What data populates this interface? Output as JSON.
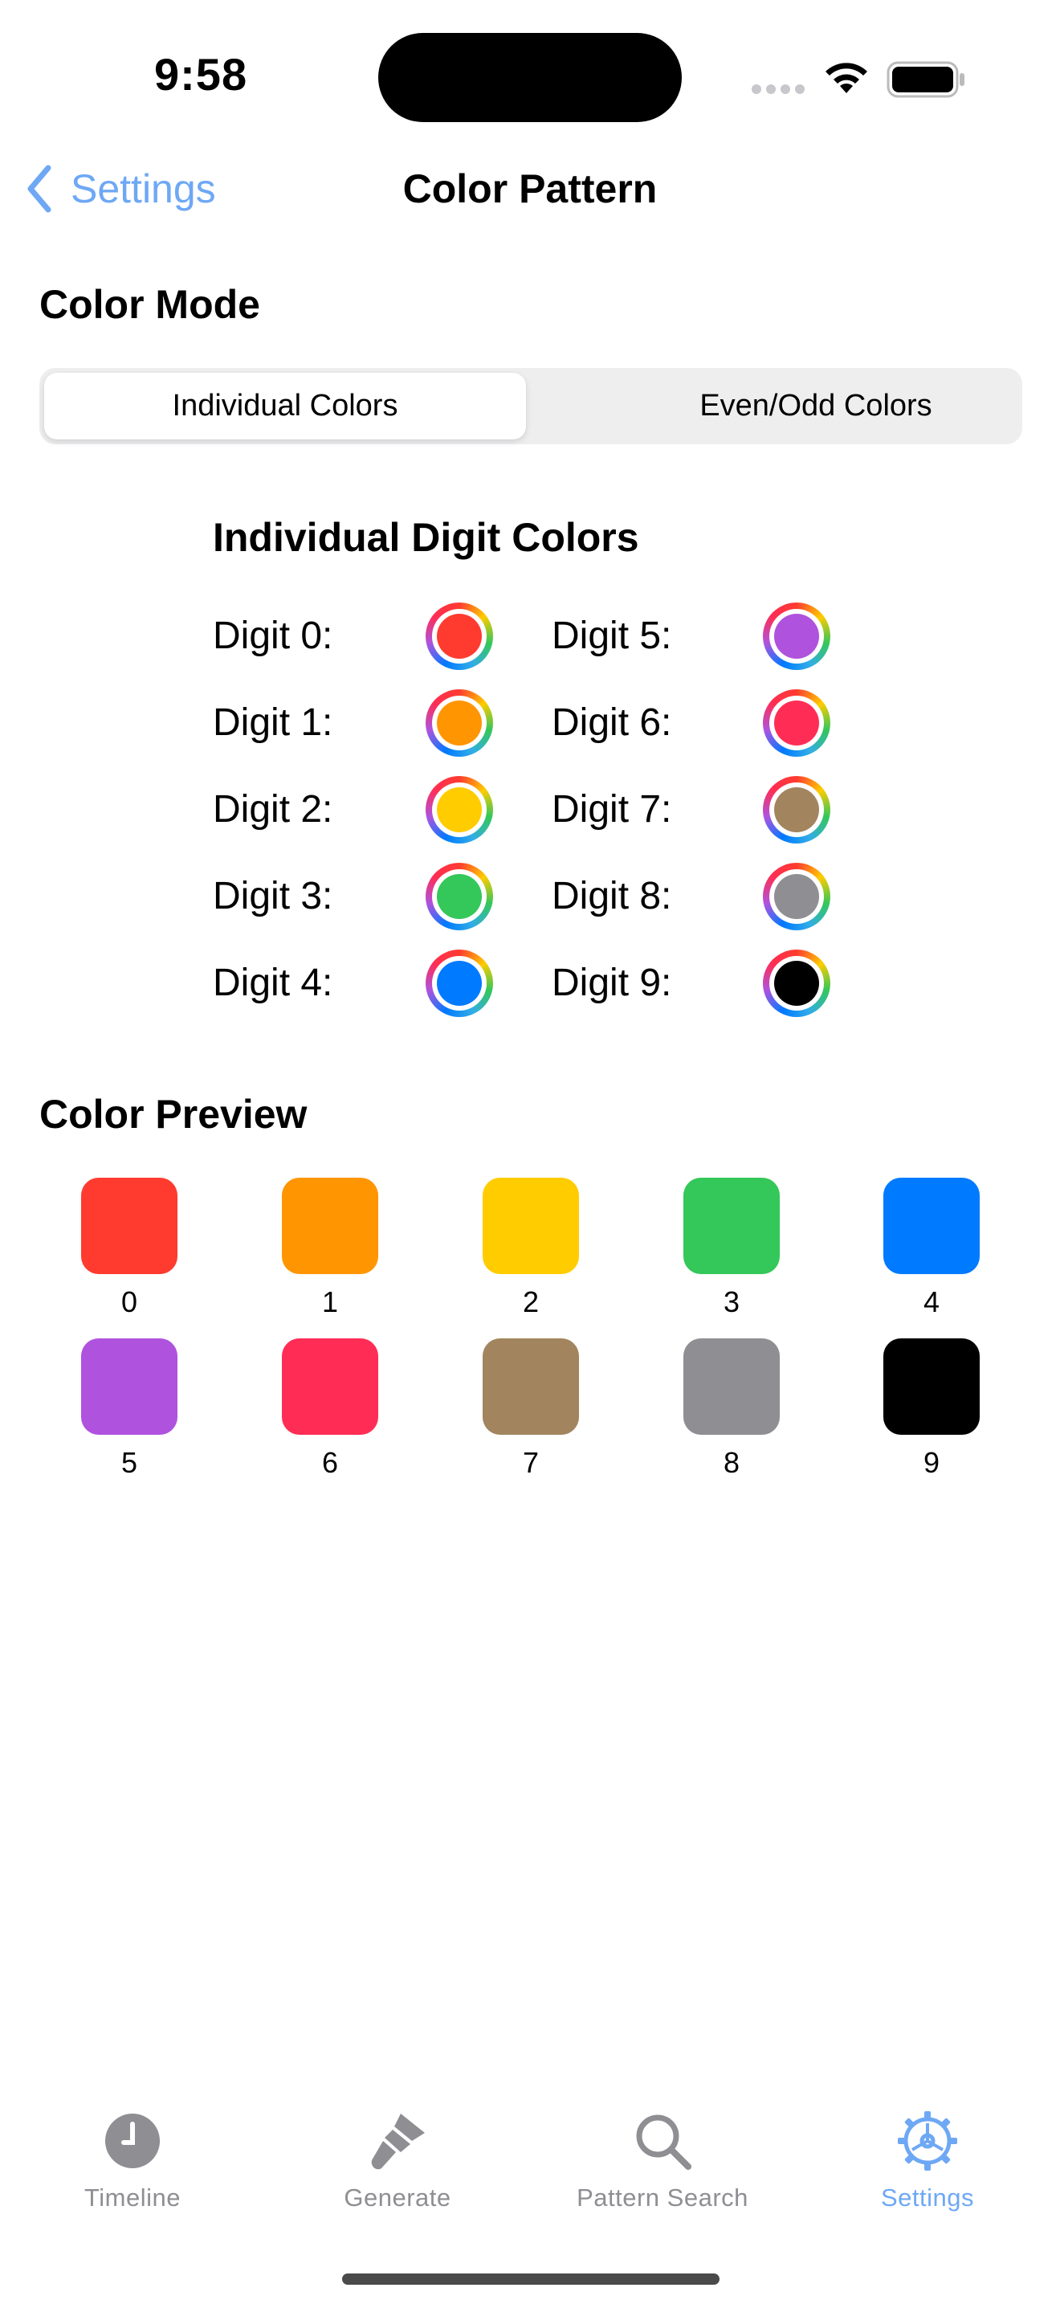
{
  "status_bar": {
    "time": "9:58"
  },
  "nav": {
    "back_label": "Settings",
    "title": "Color Pattern"
  },
  "color_mode": {
    "heading": "Color Mode",
    "segments": [
      "Individual Colors",
      "Even/Odd Colors"
    ],
    "selected": "Individual Colors"
  },
  "digit_colors": {
    "heading": "Individual Digit Colors",
    "items": [
      {
        "label": "Digit 0:",
        "color": "#ff3b30"
      },
      {
        "label": "Digit 1:",
        "color": "#ff9500"
      },
      {
        "label": "Digit 2:",
        "color": "#ffcc00"
      },
      {
        "label": "Digit 3:",
        "color": "#34c759"
      },
      {
        "label": "Digit 4:",
        "color": "#007aff"
      },
      {
        "label": "Digit 5:",
        "color": "#af52de"
      },
      {
        "label": "Digit 6:",
        "color": "#ff2d55"
      },
      {
        "label": "Digit 7:",
        "color": "#a2845e"
      },
      {
        "label": "Digit 8:",
        "color": "#8e8e93"
      },
      {
        "label": "Digit 9:",
        "color": "#000000"
      }
    ]
  },
  "preview": {
    "heading": "Color Preview",
    "items": [
      {
        "label": "0",
        "color": "#ff3b30"
      },
      {
        "label": "1",
        "color": "#ff9500"
      },
      {
        "label": "2",
        "color": "#ffcc00"
      },
      {
        "label": "3",
        "color": "#34c759"
      },
      {
        "label": "4",
        "color": "#007aff"
      },
      {
        "label": "5",
        "color": "#af52de"
      },
      {
        "label": "6",
        "color": "#ff2d55"
      },
      {
        "label": "7",
        "color": "#a2845e"
      },
      {
        "label": "8",
        "color": "#8e8e93"
      },
      {
        "label": "9",
        "color": "#000000"
      }
    ]
  },
  "tab_bar": {
    "tabs": [
      {
        "label": "Timeline",
        "icon": "clock-icon"
      },
      {
        "label": "Generate",
        "icon": "paintbrush-icon"
      },
      {
        "label": "Pattern Search",
        "icon": "magnifying-glass-icon"
      },
      {
        "label": "Settings",
        "icon": "gear-icon"
      }
    ],
    "active": "Settings",
    "active_color": "#6ea8f5",
    "inactive_color": "#8e8e93"
  }
}
